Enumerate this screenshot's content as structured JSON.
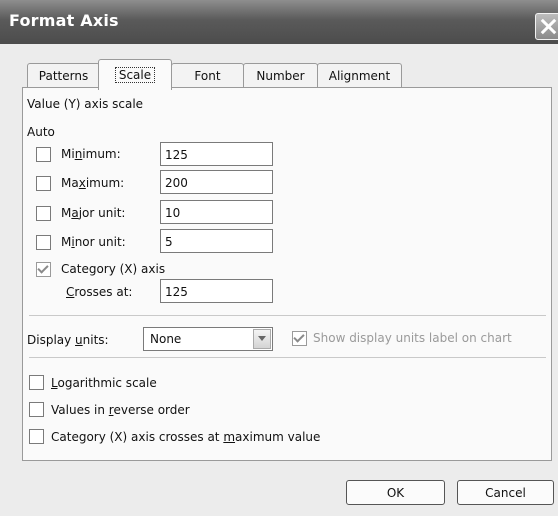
{
  "window": {
    "title": "Format Axis"
  },
  "tabs": [
    {
      "label": "Patterns",
      "active": false
    },
    {
      "label": "Scale",
      "active": true
    },
    {
      "label": "Font",
      "active": false
    },
    {
      "label": "Number",
      "active": false
    },
    {
      "label": "Alignment",
      "active": false
    }
  ],
  "scale": {
    "heading": "Value (Y) axis scale",
    "auto_label": "Auto",
    "minimum": {
      "label": "Minimum:",
      "value": "125",
      "auto": false
    },
    "maximum": {
      "label": "Maximum:",
      "value": "200",
      "auto": false
    },
    "major_unit": {
      "label": "Major unit:",
      "value": "10",
      "auto": false
    },
    "minor_unit": {
      "label": "Minor unit:",
      "value": "5",
      "auto": false
    },
    "category_axis": {
      "label": "Category (X) axis",
      "auto": true
    },
    "crosses_at": {
      "label": "Crosses at:",
      "value": "125"
    }
  },
  "display_units": {
    "label": "Display units:",
    "value": "None",
    "show_label": "Show display units label on chart",
    "show_label_checked": true,
    "show_label_enabled": false
  },
  "options": {
    "logarithmic": {
      "label": "Logarithmic scale",
      "checked": false
    },
    "reverse": {
      "label": "Values in reverse order",
      "checked": false
    },
    "crosses_max": {
      "label": "Category (X) axis crosses at maximum value",
      "checked": false
    }
  },
  "buttons": {
    "ok": "OK",
    "cancel": "Cancel"
  },
  "colors": {
    "titlebar": "#5a5a5a",
    "dialog_bg": "#ececec",
    "panel_bg": "#fafafa"
  }
}
